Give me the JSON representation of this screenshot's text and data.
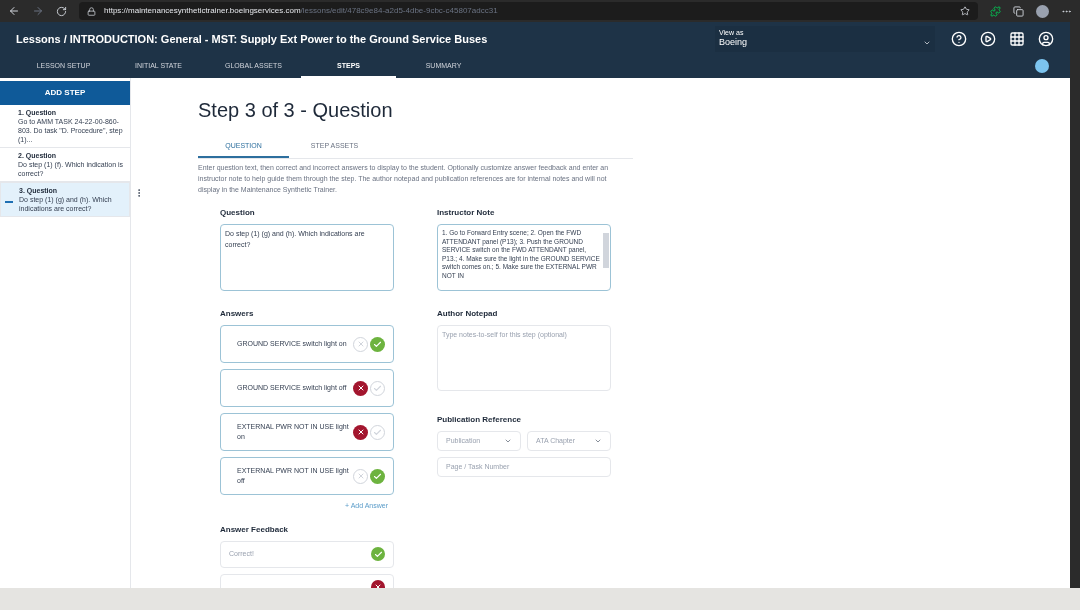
{
  "browser": {
    "url_host": "https://maintenancesynthetictrainer.boeingservices.com",
    "url_path": "/lessons/edit/478c9e84-a2d5-4dbe-9cbc-c45807adcc31"
  },
  "header": {
    "title": "Lessons / INTRODUCTION: General - MST: Supply Ext Power to the Ground Service Buses",
    "view_as": {
      "label": "View as",
      "value": "Boeing"
    }
  },
  "tabs": [
    {
      "label": "LESSON SETUP",
      "selected": false
    },
    {
      "label": "INITIAL STATE",
      "selected": false
    },
    {
      "label": "GLOBAL ASSETS",
      "selected": false
    },
    {
      "label": "STEPS",
      "selected": true
    },
    {
      "label": "SUMMARY",
      "selected": false
    }
  ],
  "sidebar": {
    "add_button": "ADD STEP",
    "steps": [
      {
        "title": "1. Question",
        "text": "Go to AMM TASK 24-22-00-860-803. Do task \"D. Procedure\", step (1)...",
        "selected": false
      },
      {
        "title": "2. Question",
        "text": "Do step (1) (f). Which indication is correct?",
        "selected": false
      },
      {
        "title": "3. Question",
        "text": "Do step (1) (g) and (h). Which indications are correct?",
        "selected": true
      }
    ]
  },
  "page": {
    "heading": "Step 3 of 3 - Question",
    "subtabs": [
      {
        "label": "QUESTION",
        "selected": true
      },
      {
        "label": "STEP ASSETS",
        "selected": false
      }
    ],
    "description": "Enter question text, then correct and incorrect answers to display to the student. Optionally customize answer feedback and enter an instructor note to help guide them through the step. The author notepad and publication references are for internal notes and will not display in the Maintenance Synthetic Trainer.",
    "question": {
      "label": "Question",
      "value": "Do step (1) (g) and (h). Which indications are correct?"
    },
    "answers": {
      "label": "Answers",
      "items": [
        {
          "text": "GROUND SERVICE switch light on",
          "correct": true
        },
        {
          "text": "GROUND SERVICE switch light off",
          "correct": false
        },
        {
          "text": "EXTERNAL PWR NOT IN USE light on",
          "correct": false
        },
        {
          "text": "EXTERNAL PWR NOT IN USE light off",
          "correct": true
        }
      ],
      "add": "+ Add Answer"
    },
    "feedback": {
      "label": "Answer Feedback",
      "items": [
        {
          "placeholder": "Correct!",
          "correct": true
        },
        {
          "correct": false
        }
      ]
    },
    "instructor_note": {
      "label": "Instructor Note",
      "value": "1. Go to Forward Entry scene; 2. Open the FWD ATTENDANT panel (P13); 3. Push the GROUND SERVICE switch on the FWD ATTENDANT panel, P13.; 4. Make sure the light in the GROUND SERVICE switch comes on.; 5. Make sure the EXTERNAL PWR NOT IN"
    },
    "author_notepad": {
      "label": "Author Notepad",
      "placeholder": "Type notes-to-self for this step (optional)"
    },
    "publication": {
      "label": "Publication Reference",
      "publication_placeholder": "Publication",
      "chapter_placeholder": "ATA Chapter",
      "page_placeholder": "Page / Task Number"
    }
  }
}
